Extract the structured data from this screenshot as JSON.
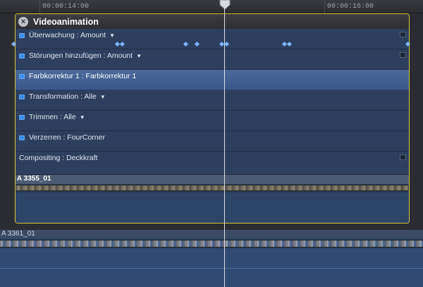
{
  "ruler": {
    "timecodes": [
      "00:00:14:00",
      "00:00:16:00"
    ]
  },
  "panel": {
    "title": "Videoanimation",
    "rows": [
      {
        "label": "Überwachung : Amount",
        "dropdown": true,
        "checkbox": true,
        "mini_button": true
      },
      {
        "label": "Störungen hinzufügen : Amount",
        "dropdown": true,
        "checkbox": true,
        "mini_button": true
      },
      {
        "label": "Farbkorrektur 1 : Farbkorrektur 1",
        "dropdown": false,
        "checkbox": true,
        "selected": true
      },
      {
        "label": "Transformation : Alle",
        "dropdown": true,
        "checkbox": true
      },
      {
        "label": "Trimmen : Alle",
        "dropdown": true,
        "checkbox": true
      },
      {
        "label": "Verzerren : FourCorner",
        "dropdown": false,
        "checkbox": true
      },
      {
        "label": "Compositing : Deckkraft",
        "dropdown": false,
        "checkbox": false,
        "mini_button": true
      }
    ],
    "clip": {
      "label": "A   3355_01"
    }
  },
  "lower_clip": {
    "label": "A   3361_01"
  },
  "colors": {
    "panel_border": "#d6c63a",
    "selected_row": "#4b6a9a",
    "keyframe": "#7fb4ff",
    "checkbox": "#3a8de8"
  },
  "icons": [
    "close-icon",
    "dropdown-arrow-icon",
    "playhead-icon",
    "keyframe-icon"
  ]
}
